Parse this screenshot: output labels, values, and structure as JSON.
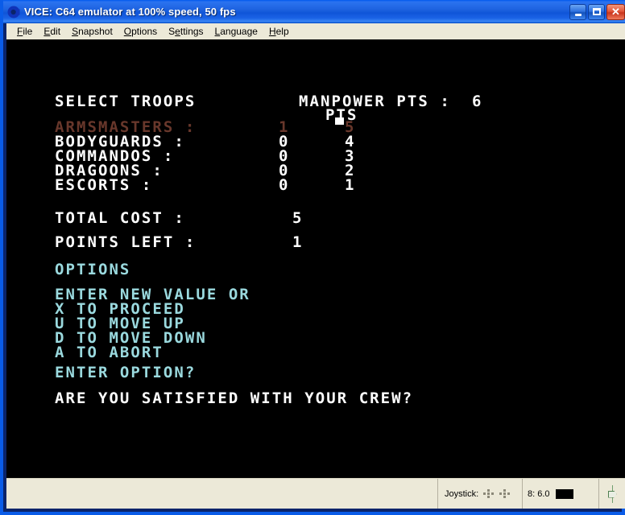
{
  "window": {
    "title": "VICE: C64 emulator at 100% speed, 50 fps",
    "icon": "commodore-logo-icon",
    "buttons": {
      "minimize": "_",
      "maximize": "□",
      "close": "✕"
    }
  },
  "menubar": {
    "items": [
      {
        "label": "File",
        "accel": "F",
        "rest": "ile"
      },
      {
        "label": "Edit",
        "accel": "E",
        "rest": "dit"
      },
      {
        "label": "Snapshot",
        "accel": "S",
        "rest": "napshot"
      },
      {
        "label": "Options",
        "accel": "O",
        "rest": "ptions"
      },
      {
        "label": "Settings",
        "accel": "Se",
        "rest": "ttings"
      },
      {
        "label": "Language",
        "accel": "L",
        "rest": "anguage"
      },
      {
        "label": "Help",
        "accel": "H",
        "rest": "elp"
      }
    ]
  },
  "screen": {
    "background": "#000000",
    "colors": {
      "white": "#ffffff",
      "red": "#68372b",
      "cyan": "#9ad9de"
    },
    "header": {
      "select_troops": "SELECT TROOPS",
      "manpower_label": "MANPOWER PTS :",
      "manpower_value": "6",
      "pts_column_header": "PTS"
    },
    "troops": [
      {
        "name": "ARMSMASTERS :",
        "count": "1",
        "pts": "5",
        "color": "red",
        "selected": true
      },
      {
        "name": "BODYGUARDS :",
        "count": "0",
        "pts": "4",
        "color": "white",
        "selected": false
      },
      {
        "name": "COMMANDOS :",
        "count": "0",
        "pts": "3",
        "color": "white",
        "selected": false
      },
      {
        "name": "DRAGOONS :",
        "count": "0",
        "pts": "2",
        "color": "white",
        "selected": false
      },
      {
        "name": "ESCORTS :",
        "count": "0",
        "pts": "1",
        "color": "white",
        "selected": false
      }
    ],
    "totals": {
      "total_cost_label": "TOTAL COST :",
      "total_cost_value": "5",
      "points_left_label": "POINTS LEFT :",
      "points_left_value": "1"
    },
    "options_heading": "OPTIONS",
    "options": [
      "ENTER NEW VALUE OR",
      "X TO PROCEED",
      "U TO MOVE UP",
      "D TO MOVE DOWN",
      "A TO ABORT"
    ],
    "prompt": "ENTER OPTION?",
    "question": "ARE YOU SATISFIED WITH YOUR CREW?"
  },
  "statusbar": {
    "joystick_label": "Joystick:",
    "drive_text": "8: 6.0",
    "drive_led_color": "#000000",
    "tape_icon": "tape-counter-icon"
  }
}
